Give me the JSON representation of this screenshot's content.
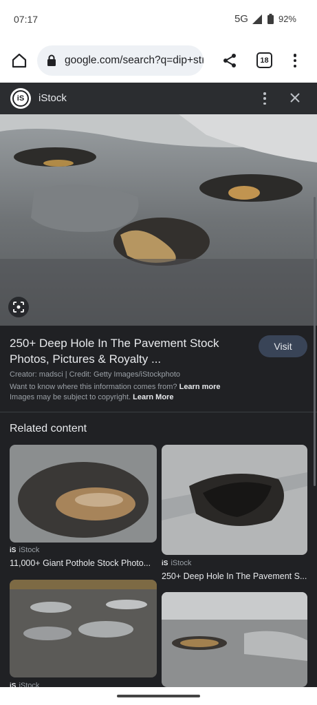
{
  "status_bar": {
    "time": "07:17",
    "network": "5G",
    "battery": "92%"
  },
  "toolbar": {
    "url": "google.com/search?q=dip+stı",
    "tab_count": "18"
  },
  "panel": {
    "source_name": "iStock",
    "logo_text": "iS",
    "result_title": "250+ Deep Hole In The Pavement Stock Photos, Pictures & Royalty ...",
    "visit_label": "Visit",
    "credit": "Creator: madsci | Credit: Getty Images/iStockphoto",
    "info_text": "Want to know where this information comes from?",
    "info_link": "Learn more",
    "copyright_text": "Images may be subject to copyright.",
    "copyright_link": "Learn More"
  },
  "related": {
    "heading": "Related content",
    "items": [
      {
        "source": "iStock",
        "title": "11,000+ Giant Pothole Stock Photo..."
      },
      {
        "source": "iStock",
        "title": "250+ Deep Hole In The Pavement S..."
      },
      {
        "source": "iStock",
        "title": ""
      },
      {
        "source": "",
        "title": ""
      }
    ]
  },
  "icons": {
    "home": "home-icon",
    "lock": "lock-icon",
    "share": "share-icon",
    "menu": "more-vert-icon",
    "close": "close-icon",
    "lens": "lens-icon",
    "signal": "signal-icon",
    "battery": "battery-icon"
  },
  "colors": {
    "panel_bg": "#202124",
    "visit_bg": "#394457",
    "url_bg": "#eef1f5"
  }
}
